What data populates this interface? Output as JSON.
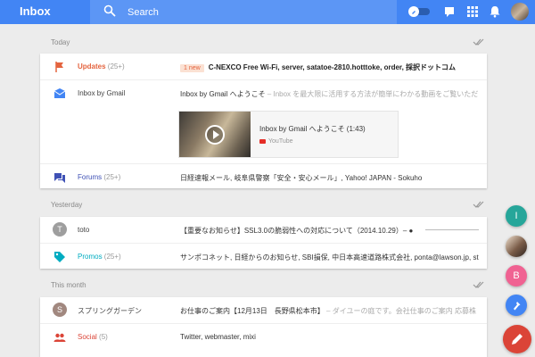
{
  "header": {
    "app_title": "Inbox",
    "search_placeholder": "Search",
    "accent_color": "#4285f4",
    "icons": [
      "search-icon",
      "pin-toggle-icon",
      "reminder-bulb-icon",
      "apps-grid-icon",
      "notifications-bell-icon",
      "account-avatar"
    ]
  },
  "sections": {
    "today": {
      "label": "Today"
    },
    "yesterday": {
      "label": "Yesterday"
    },
    "month": {
      "label": "This month"
    }
  },
  "today": {
    "updates": {
      "sender": "Updates",
      "count": "(25+)",
      "badge": "1 new",
      "subject": "C-NEXCO Free Wi-Fi, server, satatoe-2810.hotttoke, order, 採択ドットコム",
      "icon": "flag-icon"
    },
    "inbox": {
      "sender": "Inbox by Gmail",
      "subject": "Inbox by Gmail へようこそ",
      "snippet": " – Inbox を最大限に活用する方法が簡単にわかる動画をご覧いただ",
      "icon": "inbox-envelope-icon",
      "attachment": {
        "title": "Inbox by Gmail へようこそ (1:43)",
        "source": "YouTube"
      }
    },
    "forums": {
      "sender": "Forums",
      "count": "(25+)",
      "subject": "日経速報メール, 岐阜県警察「安全・安心メール」, Yahoo! JAPAN - Sokuho",
      "icon": "forums-chat-icon"
    }
  },
  "yesterday": {
    "toto": {
      "sender": "toto",
      "initial": "T",
      "subject": "【重要なお知らせ】SSL3.0の脆弱性への対応について（2014.10.29）– ●"
    },
    "promos": {
      "sender": "Promos",
      "count": "(25+)",
      "subject": "サンポコネット, 日経からのお知らせ, SBI損保, 中日本高速道路株式会社, ponta@lawson.jp, st",
      "icon": "tag-icon"
    }
  },
  "month": {
    "garden": {
      "sender": "スプリングガーデン",
      "initial": "S",
      "subject": "お仕事のご案内【12月13日　長野県松本市】",
      "snippet": " – ダイユーの庭です。会社仕事のご案内 応募株"
    },
    "social": {
      "sender": "Social",
      "count": "(5)",
      "subject": "Twitter, webmaster, mixi",
      "icon": "people-icon"
    }
  },
  "fabs": {
    "i_label": "I",
    "b_label": "B",
    "colors": {
      "i": "#26a69a",
      "b": "#f06292",
      "pin": "#4285f4",
      "compose": "#db4437"
    }
  }
}
